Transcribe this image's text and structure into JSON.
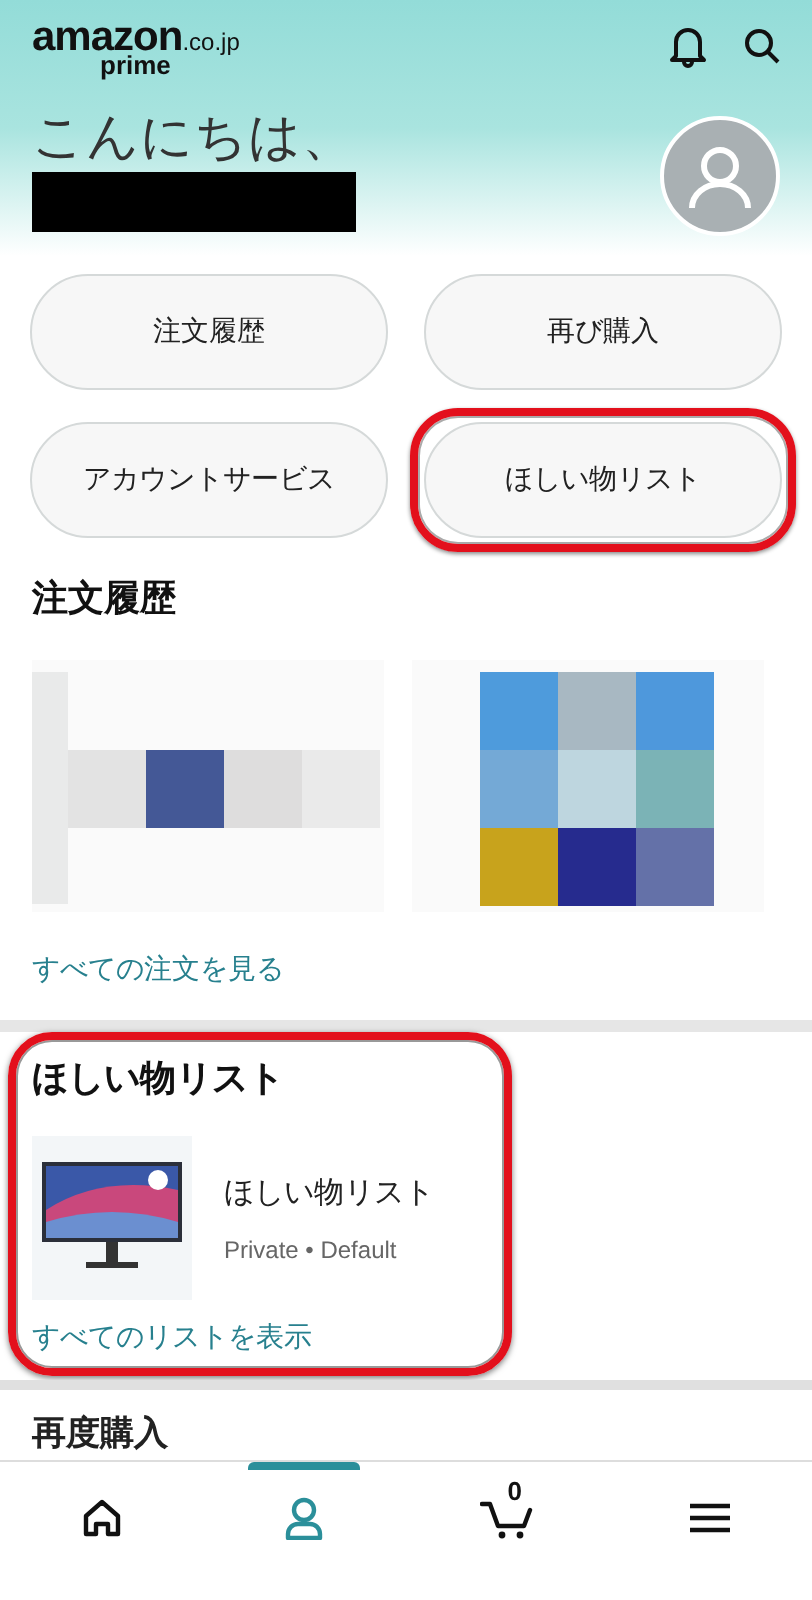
{
  "header": {
    "logo": {
      "word": "amazon",
      "domain": ".co.jp",
      "tier": "prime"
    },
    "greeting": "こんにちは、",
    "name_redacted": true
  },
  "quick_buttons": [
    {
      "label": "注文履歴",
      "highlighted": false
    },
    {
      "label": "再び購入",
      "highlighted": false
    },
    {
      "label": "アカウントサービス",
      "highlighted": false
    },
    {
      "label": "ほしい物リスト",
      "highlighted": true
    }
  ],
  "orders": {
    "title": "注文履歴",
    "link": "すべての注文を見る"
  },
  "wishlist": {
    "title": "ほしい物リスト",
    "highlighted": true,
    "list": {
      "name": "ほしい物リスト",
      "meta": "Private • Default"
    },
    "link": "すべてのリストを表示"
  },
  "buy_again": {
    "title": "再度購入"
  },
  "nav": [
    {
      "kind": "home",
      "selected": false
    },
    {
      "kind": "account",
      "selected": true
    },
    {
      "kind": "cart",
      "selected": false,
      "count": "0"
    },
    {
      "kind": "menu",
      "selected": false
    }
  ]
}
